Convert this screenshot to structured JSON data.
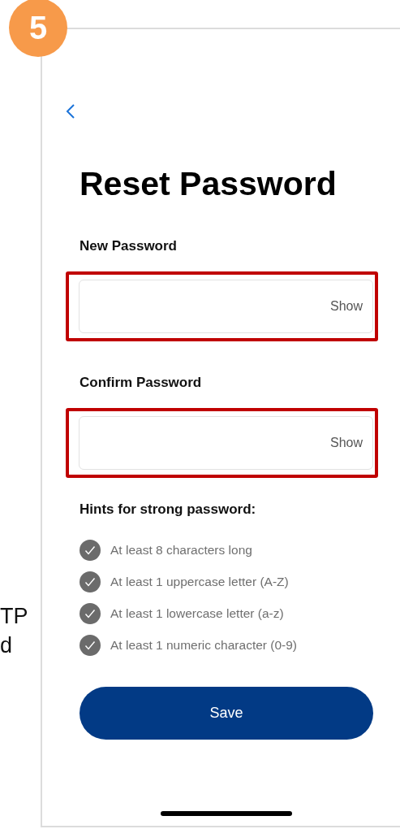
{
  "step_badge": "5",
  "side_text": [
    "TP",
    "d"
  ],
  "screen": {
    "title": "Reset Password",
    "fields": [
      {
        "label": "New Password",
        "toggle": "Show",
        "highlighted": true
      },
      {
        "label": "Confirm Password",
        "toggle": "Show",
        "highlighted": true
      }
    ],
    "hints_title": "Hints for strong password:",
    "hints": [
      {
        "text": "At least 8 characters long",
        "met": true
      },
      {
        "text": "At least 1 uppercase letter (A-Z)",
        "met": true
      },
      {
        "text": "At least 1 lowercase letter (a-z)",
        "met": true
      },
      {
        "text": "At least 1 numeric character (0-9)",
        "met": true
      }
    ],
    "save_button": "Save"
  }
}
